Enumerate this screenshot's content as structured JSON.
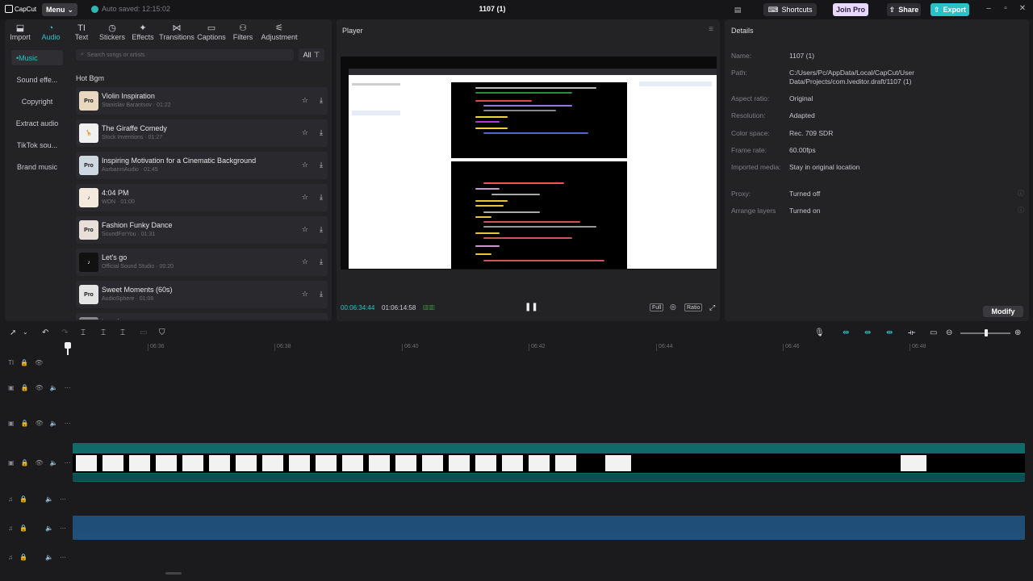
{
  "titlebar": {
    "logo": "CapCut",
    "menu_label": "Menu",
    "autosave": "Auto saved: 12:15:02",
    "project_title": "1107 (1)",
    "shortcuts": "Shortcuts",
    "join_pro": "Join Pro",
    "share": "Share",
    "export": "Export"
  },
  "toolbar_tabs": [
    {
      "label": "Import",
      "icon": "import-icon"
    },
    {
      "label": "Audio",
      "icon": "audio-icon"
    },
    {
      "label": "Text",
      "icon": "text-icon"
    },
    {
      "label": "Stickers",
      "icon": "stickers-icon"
    },
    {
      "label": "Effects",
      "icon": "effects-icon"
    },
    {
      "label": "Transitions",
      "icon": "transitions-icon"
    },
    {
      "label": "Captions",
      "icon": "captions-icon"
    },
    {
      "label": "Filters",
      "icon": "filters-icon"
    },
    {
      "label": "Adjustment",
      "icon": "adjustment-icon"
    }
  ],
  "sidebar": [
    "Music",
    "Sound effe...",
    "Copyright",
    "Extract audio",
    "TikTok sou...",
    "Brand music"
  ],
  "search_placeholder": "Search songs or artists",
  "filter_label": "All",
  "section_title": "Hot Bgm",
  "songs": [
    {
      "title": "Violin Inspiration",
      "meta": "Stanislav Barantsov · 01:22"
    },
    {
      "title": "The Giraffe Comedy",
      "meta": "Stock Inventions · 01:27"
    },
    {
      "title": "Inspiring Motivation for a Cinematic Background",
      "meta": "AurbanniAudio · 01:45"
    },
    {
      "title": "4:04 PM",
      "meta": "WON · 01:00"
    },
    {
      "title": "Fashion Funky Dance",
      "meta": "SoundForYou · 01:31"
    },
    {
      "title": "Let's go",
      "meta": "Official Sound Studio · 00:20"
    },
    {
      "title": "Sweet Moments (60s)",
      "meta": "AudioSphere · 01:08"
    },
    {
      "title": "kyrathe",
      "meta": ""
    }
  ],
  "player": {
    "title": "Player",
    "time_current": "00:06:34:44",
    "time_total": "01:06:14:58",
    "full": "Full",
    "ratio": "Ratio"
  },
  "details": {
    "title": "Details",
    "rows": [
      {
        "label": "Name:",
        "value": "1107 (1)"
      },
      {
        "label": "Path:",
        "value": "C:/Users/Pc/AppData/Local/CapCut/User Data/Projects/com.lveditor.draft/1107 (1)"
      },
      {
        "label": "Aspect ratio:",
        "value": "Original"
      },
      {
        "label": "Resolution:",
        "value": "Adapted"
      },
      {
        "label": "Color space:",
        "value": "Rec. 709 SDR"
      },
      {
        "label": "Frame rate:",
        "value": "60.00fps"
      },
      {
        "label": "Imported media:",
        "value": "Stay in original location"
      },
      {
        "label": "Proxy:",
        "value": "Turned off"
      },
      {
        "label": "Arrange layers",
        "value": "Turned on"
      }
    ],
    "modify": "Modify"
  },
  "ruler_ticks": [
    "06:36",
    "06:38",
    "06:40",
    "06:42",
    "06:44",
    "06:46",
    "06:48"
  ]
}
